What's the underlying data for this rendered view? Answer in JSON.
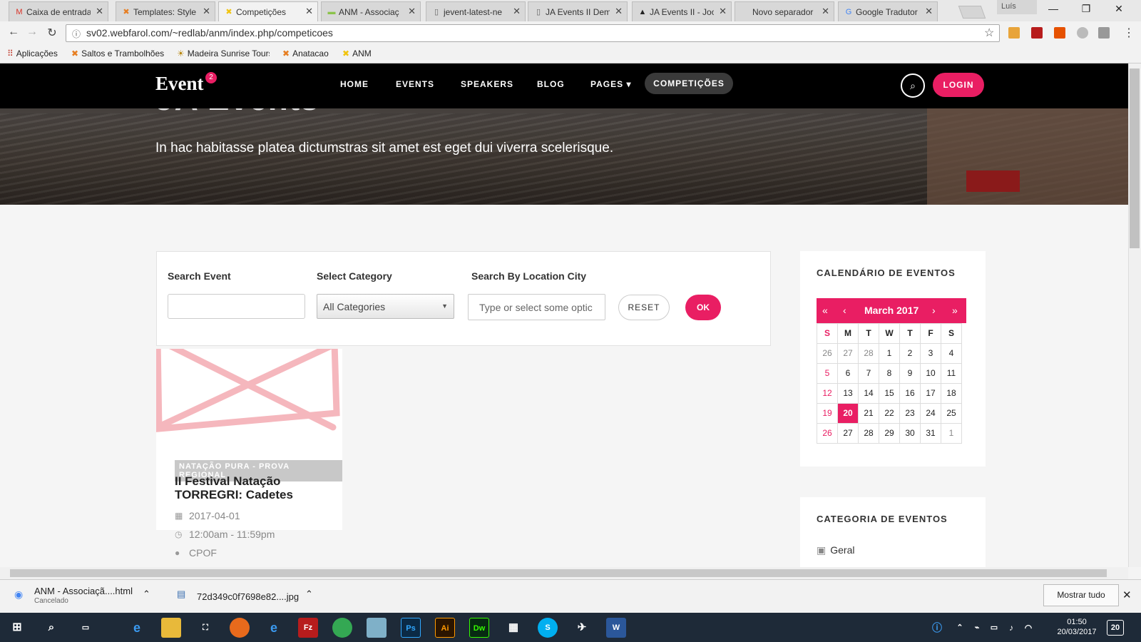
{
  "browser": {
    "tabs": [
      {
        "label": "Caixa de entrada",
        "icon": "gmail-icon"
      },
      {
        "label": "Templates: Style",
        "icon": "joomla-icon"
      },
      {
        "label": "Competições",
        "icon": "site-icon",
        "active": true
      },
      {
        "label": "ANM - Associaç",
        "icon": "page-icon"
      },
      {
        "label": "jevent-latest-ne",
        "icon": "doc-icon"
      },
      {
        "label": "JA Events II Dem",
        "icon": "doc-icon"
      },
      {
        "label": "JA Events II - Joo",
        "icon": "ja-icon"
      },
      {
        "label": "Novo separador",
        "icon": "blank-icon"
      },
      {
        "label": "Google Tradutor",
        "icon": "translate-icon"
      }
    ],
    "profile_name": "Luís",
    "url": "sv02.webfarol.com/~redlab/anm/index.php/competicoes",
    "bookmarks": [
      {
        "label": "Aplicações",
        "icon": "apps-icon"
      },
      {
        "label": "Saltos e Trambolhões",
        "icon": "joomla-icon"
      },
      {
        "label": "Madeira Sunrise Tours",
        "icon": "sun-icon"
      },
      {
        "label": "Anatacao",
        "icon": "joomla-icon"
      },
      {
        "label": "ANM",
        "icon": "site-icon"
      }
    ]
  },
  "site": {
    "logo": "Event",
    "logo_badge": "2",
    "nav": [
      "HOME",
      "EVENTS",
      "SPEAKERS",
      "BLOG",
      "PAGES ▾",
      "COMPETIÇÕES"
    ],
    "login": "LOGIN",
    "hero_title": "JA Events",
    "hero_subtitle": "In hac habitasse platea dictumstras sit amet est eget dui viverra scelerisque."
  },
  "search": {
    "event_label": "Search Event",
    "event_value": "",
    "category_label": "Select Category",
    "category_value": "All Categories",
    "city_label": "Search By Location City",
    "city_placeholder": "Type or select some optic",
    "reset": "RESET",
    "ok": "OK"
  },
  "event": {
    "category": "NATAÇÃO PURA - PROVA REGIONAL",
    "title": "II Festival Natação TORREGRI: Cadetes",
    "date": "2017-04-01",
    "time": "12:00am - 11:59pm",
    "location": "CPOF"
  },
  "calendar": {
    "widget_title": "CALENDÁRIO DE EVENTOS",
    "month": "March 2017",
    "nav": {
      "prev_year": "«",
      "prev": "‹",
      "next": "›",
      "next_year": "»"
    },
    "weekdays": [
      "S",
      "M",
      "T",
      "W",
      "T",
      "F",
      "S"
    ],
    "weeks": [
      [
        "26",
        "27",
        "28",
        "1",
        "2",
        "3",
        "4"
      ],
      [
        "5",
        "6",
        "7",
        "8",
        "9",
        "10",
        "11"
      ],
      [
        "12",
        "13",
        "14",
        "15",
        "16",
        "17",
        "18"
      ],
      [
        "19",
        "20",
        "21",
        "22",
        "23",
        "24",
        "25"
      ],
      [
        "26",
        "27",
        "28",
        "29",
        "30",
        "31",
        "1"
      ]
    ],
    "today": "20",
    "accent": "#e91e63"
  },
  "categories": {
    "widget_title": "CATEGORIA DE EVENTOS",
    "items": [
      "Geral"
    ]
  },
  "downloads": {
    "items": [
      {
        "name": "ANM - Associaçã....html",
        "status": "Cancelado"
      },
      {
        "name": "72d349c0f7698e82....jpg",
        "status": ""
      }
    ],
    "show_all": "Mostrar tudo"
  },
  "taskbar": {
    "time": "01:50",
    "date": "20/03/2017",
    "notifications": "20"
  }
}
